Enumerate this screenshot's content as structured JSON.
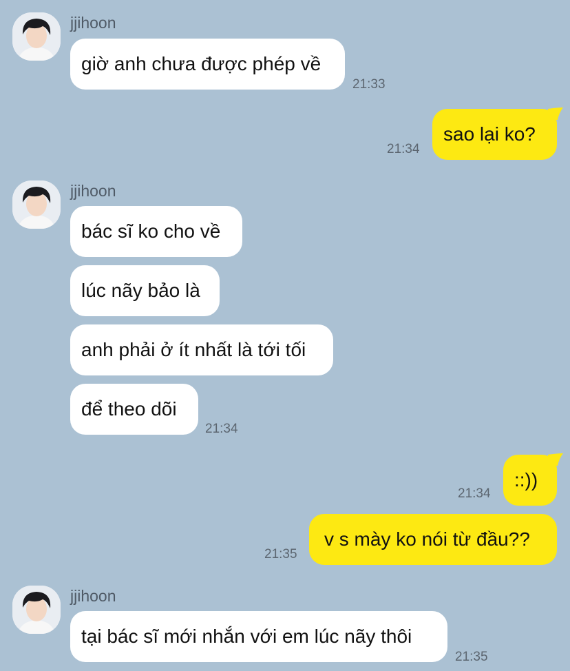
{
  "sender_name": "jjihoon",
  "messages": {
    "m1": {
      "text": "giờ anh chưa được phép về",
      "time": "21:33"
    },
    "m2": {
      "text": "sao lại ko?",
      "time": "21:34"
    },
    "m3": {
      "text": "bác sĩ ko cho về"
    },
    "m4": {
      "text": "lúc nãy bảo là"
    },
    "m5": {
      "text": "anh phải ở ít nhất là tới tối"
    },
    "m6": {
      "text": "để theo dõi",
      "time": "21:34"
    },
    "m7": {
      "text": "::))",
      "time": "21:34"
    },
    "m8": {
      "text": "v s mày ko nói từ đầu??",
      "time": "21:35"
    },
    "m9": {
      "text": "tại bác sĩ mới nhắn với em lúc nãy thôi",
      "time": "21:35"
    }
  },
  "colors": {
    "background": "#abc1d3",
    "incoming_bubble": "#ffffff",
    "outgoing_bubble": "#fde912"
  },
  "icons": {
    "avatar": "profile-photo"
  }
}
